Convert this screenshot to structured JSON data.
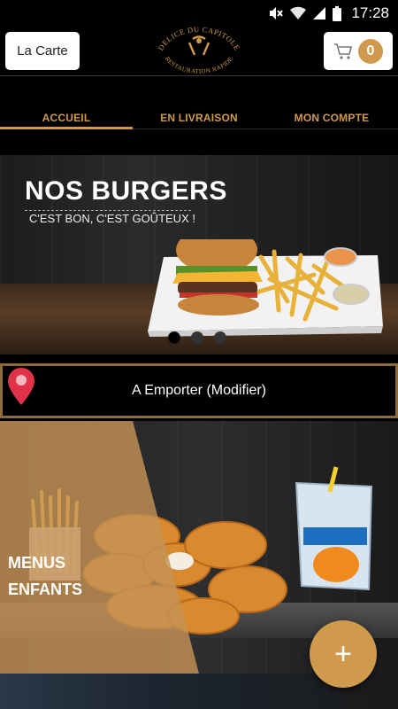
{
  "status_bar": {
    "time": "17:28",
    "icons": [
      "mute-icon",
      "wifi-icon",
      "signal-icon",
      "battery-icon"
    ]
  },
  "header": {
    "menu_label": "La Carte",
    "logo_text_top": "DELICE DU CAPITOLE",
    "logo_text_bottom": "RESTAURATION RAPIDE",
    "cart_count": "0"
  },
  "tabs": [
    {
      "label": "ACCUEIL",
      "active": true
    },
    {
      "label": "EN LIVRAISON",
      "active": false
    },
    {
      "label": "MON COMPTE",
      "active": false
    }
  ],
  "banner": {
    "title": "NOS BURGERS",
    "subtitle": "C'EST BON, C'EST GOÛTEUX !",
    "slides": 3,
    "active_slide": 1
  },
  "order_mode": {
    "label": "A Emporter (Modifier)"
  },
  "categories": [
    {
      "label_line1": "MENUS",
      "label_line2": "ENFANTS"
    }
  ],
  "fab": {
    "label": "+"
  },
  "colors": {
    "accent": "#d09a4c",
    "background": "#000000",
    "pin": "#e0334a"
  }
}
